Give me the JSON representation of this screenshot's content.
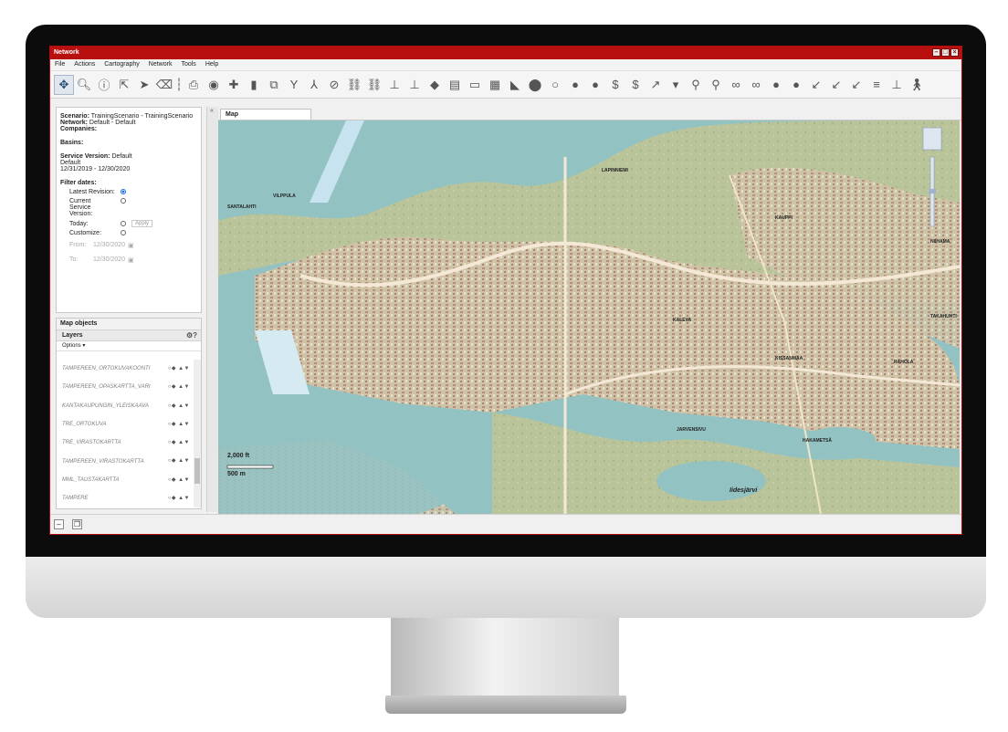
{
  "window": {
    "title": "Network",
    "controls": [
      "–",
      "□",
      "×"
    ]
  },
  "menu": [
    "File",
    "Actions",
    "Cartography",
    "Network",
    "Tools",
    "Help"
  ],
  "toolbar": {
    "icons": [
      "move-icon",
      "zoom-icon",
      "info-icon",
      "select-icon",
      "pointer-icon",
      "eraser-icon",
      "separator-icon",
      "print-icon",
      "eye-icon",
      "layers-icon",
      "stop-icon",
      "route-icon",
      "fork-icon",
      "path-icon",
      "direction-icon",
      "trip-icon",
      "trip-alt-icon",
      "pin-icon",
      "pin-add-icon",
      "stack-icon",
      "grid-icon",
      "panel-icon",
      "table-icon",
      "tag-icon",
      "location-icon",
      "location-outline-icon",
      "location-edit-icon",
      "location-delete-icon",
      "dollar-icon",
      "dollar-edit-icon",
      "measure-icon",
      "dropdown-icon",
      "route-point-icon",
      "route-edit-icon",
      "link-icon",
      "link-edit-icon",
      "location-plus-icon",
      "location-minus-icon",
      "arrow-downleft-icon",
      "arrow-downleft-line-icon",
      "arrow-downleft-edit-icon",
      "align-icon",
      "align-bottom-icon",
      "walk-icon"
    ]
  },
  "scenario": {
    "scenario_label": "Scenario:",
    "scenario_value": "TrainingScenario - TrainingScenario",
    "network_label": "Network:",
    "network_value": "Default - Default",
    "companies_label": "Companies:",
    "basins_label": "Basins:",
    "service_version_label": "Service Version:",
    "service_version_value": "Default",
    "service_version_line2": "Default",
    "date_range": "12/31/2019 - 12/30/2020",
    "filter_dates_label": "Filter dates:",
    "options": {
      "latest": "Latest Revision:",
      "current": "Current Service Version:",
      "today": "Today:",
      "customize": "Customize:"
    },
    "apply": "Apply",
    "from_label": "From:",
    "from_value": "12/30/2020",
    "to_label": "To:",
    "to_value": "12/30/2020"
  },
  "map_objects": {
    "title": "Map objects",
    "layers_title": "Layers",
    "options_label": "Options ▾",
    "layers": [
      "TAMPEREEN_ORTOKUVAKOONTI",
      "TAMPEREEN_OPASKARTTA_VARI",
      "KANTAKAUPUNGIN_YLEISKAAVA",
      "TRE_ORTOKUVA",
      "TRE_VIRASTOKARTTA",
      "TAMPEREEN_VIRASTOKARTTA",
      "MML_TAUSTAKARTTA",
      "TAMPERE"
    ]
  },
  "map_tab": {
    "label": "Map"
  },
  "scale": {
    "feet": "2,000 ft",
    "meters": "500 m"
  },
  "map_labels": [
    "NIIHAMA",
    "TAKAHUHTI",
    "KALEVA",
    "KAUPPI",
    "LAPINNIEMI",
    "SANTALAHTI",
    "JARVENSIVU",
    "Iidesjärvi",
    "HAKAMETSÄ",
    "KISSANMAA",
    "RAHOLA",
    "VILPPULA"
  ]
}
